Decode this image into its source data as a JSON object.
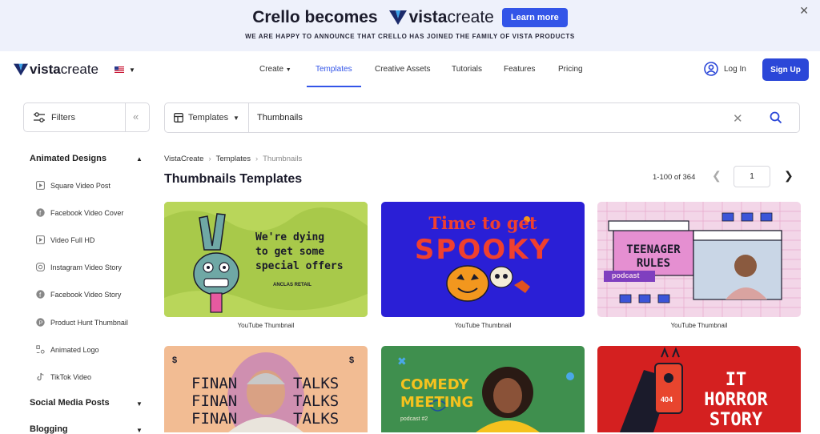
{
  "banner": {
    "title": "Crello becomes",
    "logo_word1": "vista",
    "logo_word2": "create",
    "learn_more": "Learn more",
    "subtitle": "WE ARE HAPPY TO ANNOUNCE THAT CRELLO HAS JOINED THE FAMILY OF VISTA PRODUCTS",
    "close_glyph": "✕"
  },
  "brand": {
    "word1": "vista",
    "word2": "create"
  },
  "nav": {
    "items": [
      "Create",
      "Templates",
      "Creative Assets",
      "Tutorials",
      "Features",
      "Pricing"
    ],
    "active_index": 1,
    "login": "Log In",
    "signup": "Sign Up"
  },
  "filters": {
    "label": "Filters",
    "collapse_glyph": "«"
  },
  "search": {
    "category": "Templates",
    "query": "Thumbnails",
    "clear_glyph": "✕"
  },
  "sidebar": {
    "sections": [
      {
        "label": "Animated Designs",
        "expanded": true
      },
      {
        "label": "Social Media Posts",
        "expanded": false
      },
      {
        "label": "Blogging",
        "expanded": false
      }
    ],
    "items": [
      {
        "label": "Square Video Post",
        "icon": "play-square-icon"
      },
      {
        "label": "Facebook Video Cover",
        "icon": "facebook-icon"
      },
      {
        "label": "Video Full HD",
        "icon": "play-square-icon"
      },
      {
        "label": "Instagram Video Story",
        "icon": "instagram-icon"
      },
      {
        "label": "Facebook Video Story",
        "icon": "facebook-icon"
      },
      {
        "label": "Product Hunt Thumbnail",
        "icon": "product-hunt-icon"
      },
      {
        "label": "Animated Logo",
        "icon": "logo-shape-icon"
      },
      {
        "label": "TikTok Video",
        "icon": "tiktok-icon"
      }
    ]
  },
  "breadcrumb": [
    "VistaCreate",
    "Templates",
    "Thumbnails"
  ],
  "page_title": "Thumbnails Templates",
  "pagination": {
    "range": "1-100 of 364",
    "page": "1"
  },
  "cards": [
    {
      "caption": "YouTube Thumbnail",
      "lines": [
        "We're dying",
        "to get some",
        "special offers"
      ],
      "sub": "ANCLAS RETAIL",
      "bg": "#a8c94a"
    },
    {
      "caption": "YouTube Thumbnail",
      "lines": [
        "Time to get",
        "SPOOKY"
      ],
      "bg": "#2a1fd6"
    },
    {
      "caption": "YouTube Thumbnail",
      "lines": [
        "TEENAGER",
        "RULES"
      ],
      "sub": "podcast",
      "bg": "#f3d6e8"
    },
    {
      "caption": "",
      "lines": [
        "FINAN",
        "TALKS",
        "FINAN",
        "TALKS",
        "FINAN",
        "TALKS"
      ],
      "sub": "$",
      "bg": "#f2bc93"
    },
    {
      "caption": "",
      "lines": [
        "COMEDY",
        "MEETING"
      ],
      "sub": "podcast #2",
      "bg": "#3f8f4e"
    },
    {
      "caption": "",
      "lines": [
        "IT",
        "HORROR",
        "STORY"
      ],
      "sub": "404",
      "bg": "#d42020"
    }
  ],
  "colors": {
    "accent": "#3355e8",
    "banner_bg": "#eef1fb",
    "signup_bg": "#2b47d8"
  }
}
